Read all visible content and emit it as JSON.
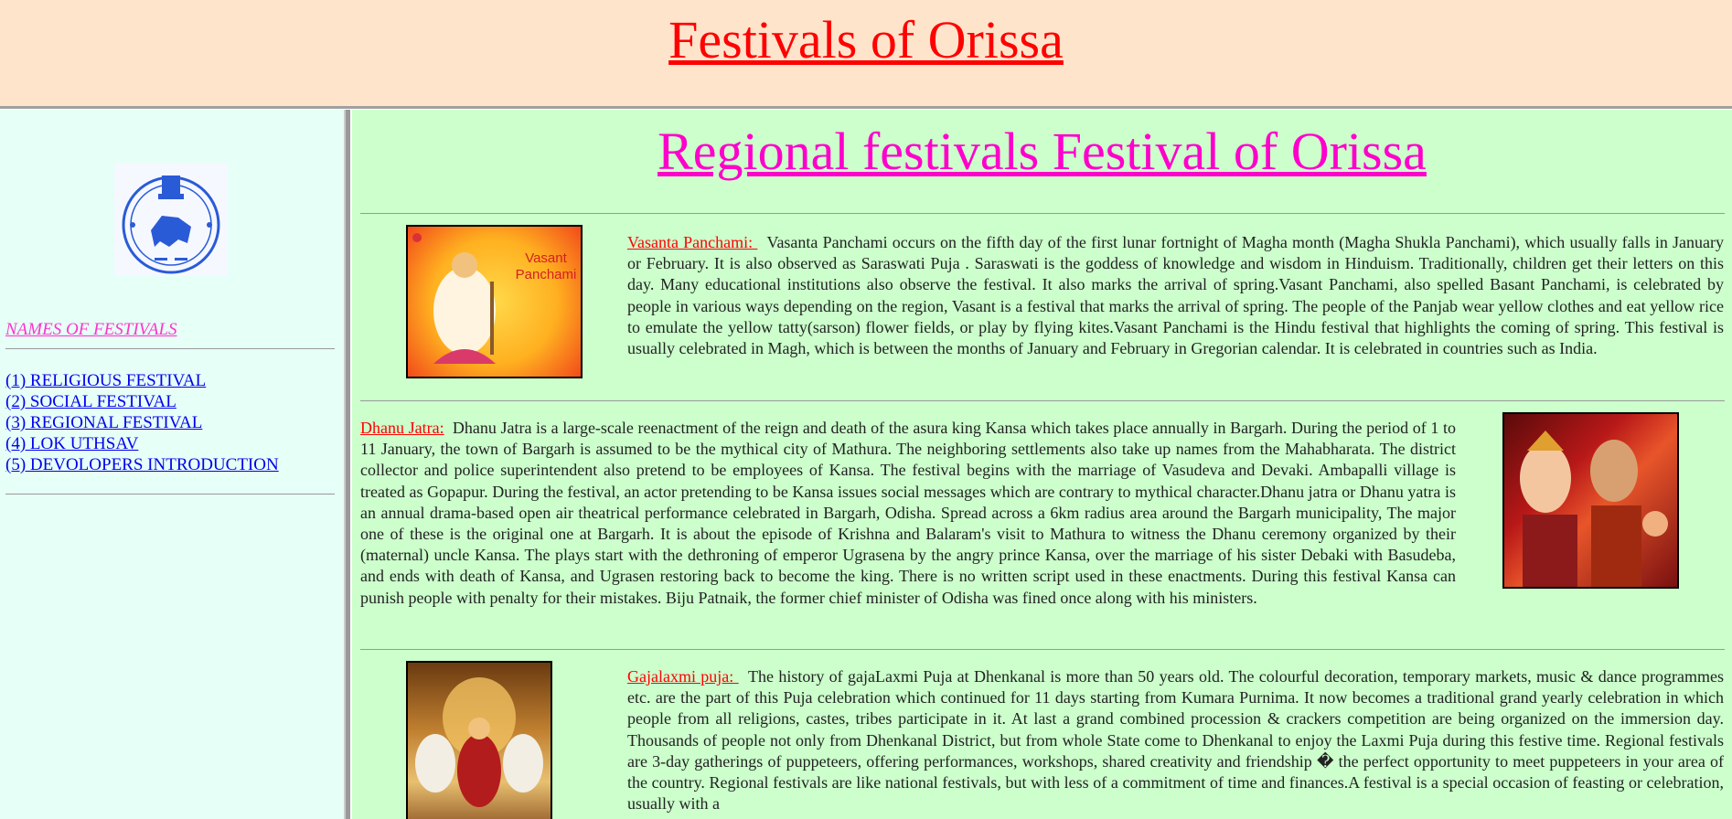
{
  "header": {
    "title": "Festivals of Orissa"
  },
  "sidebar": {
    "heading": "NAMES OF FESTIVALS",
    "items": [
      {
        "label": "(1) RELIGIOUS FESTIVAL"
      },
      {
        "label": "(2) SOCIAL FESTIVAL"
      },
      {
        "label": "(3) REGIONAL FESTIVAL"
      },
      {
        "label": "(4) LOK UTHSAV"
      },
      {
        "label": "(5) DEVOLOPERS INTRODUCTION"
      }
    ]
  },
  "main": {
    "heading": "Regional festivals Festival of Orissa",
    "festivals": [
      {
        "name": "Vasanta Panchami: ",
        "image_caption": "Vasant Panchami",
        "text": "Vasanta Panchami occurs on the fifth day of the first lunar fortnight of Magha month (Magha Shukla Panchami), which usually falls in January or February. It is also observed as Saraswati Puja . Saraswati is the goddess of knowledge and wisdom in Hinduism. Traditionally, children get their letters on this day. Many educational institutions also observe the festival. It also marks the arrival of spring.Vasant Panchami, also spelled Basant Panchami, is celebrated by people in various ways depending on the region, Vasant is a festival that marks the arrival of spring. The people of the Panjab wear yellow clothes and eat yellow rice to emulate the yellow tatty(sarson) flower fields, or play by flying kites.Vasant Panchami is the Hindu festival that highlights the coming of spring. This festival is usually celebrated in Magh, which is between the months of January and February in Gregorian calendar. It is celebrated in countries such as India."
      },
      {
        "name": "Dhanu Jatra:",
        "text": "Dhanu Jatra is a large-scale reenactment of the reign and death of the asura king Kansa which takes place annually in Bargarh. During the period of 1 to 11 January, the town of Bargarh is assumed to be the mythical city of Mathura. The neighboring settlements also take up names from the Mahabharata. The district collector and police superintendent also pretend to be employees of Kansa. The festival begins with the marriage of Vasudeva and Devaki. Ambapalli village is treated as Gopapur. During the festival, an actor pretending to be Kansa issues social messages which are contrary to mythical character.Dhanu jatra or Dhanu yatra is an annual drama-based open air theatrical performance celebrated in Bargarh, Odisha. Spread across a 6km radius area around the Bargarh municipality, The major one of these is the original one at Bargarh. It is about the episode of Krishna and Balaram's visit to Mathura to witness the Dhanu ceremony organized by their (maternal) uncle Kansa. The plays start with the dethroning of emperor Ugrasena by the angry prince Kansa, over the marriage of his sister Debaki with Basudeba, and ends with death of Kansa, and Ugrasen restoring back to become the king. There is no written script used in these enactments. During this festival Kansa can punish people with penalty for their mistakes. Biju Patnaik, the former chief minister of Odisha was fined once along with his ministers."
      },
      {
        "name": "Gajalaxmi puja: ",
        "text": "The history of gajaLaxmi Puja at Dhenkanal is more than 50 years old. The colourful decoration, temporary markets, music & dance programmes etc. are the part of this Puja celebration which continued for 11 days starting from Kumara Purnima. It now becomes a traditional grand yearly celebration in which people from all religions, castes, tribes participate in it. At last a grand combined procession & crackers competition are being organized on the immersion day. Thousands of people not only from Dhenkanal District, but from whole State come to Dhenkanal to enjoy the Laxmi Puja during this festive time. Regional festivals are 3-day gatherings of puppeteers, offering performances, workshops, shared creativity and friendship � the perfect opportunity to meet puppeteers in your area of the country. Regional festivals are like national festivals, but with less of a commitment of time and finances.A festival is a special occasion of feasting or celebration, usually with a"
      }
    ]
  }
}
